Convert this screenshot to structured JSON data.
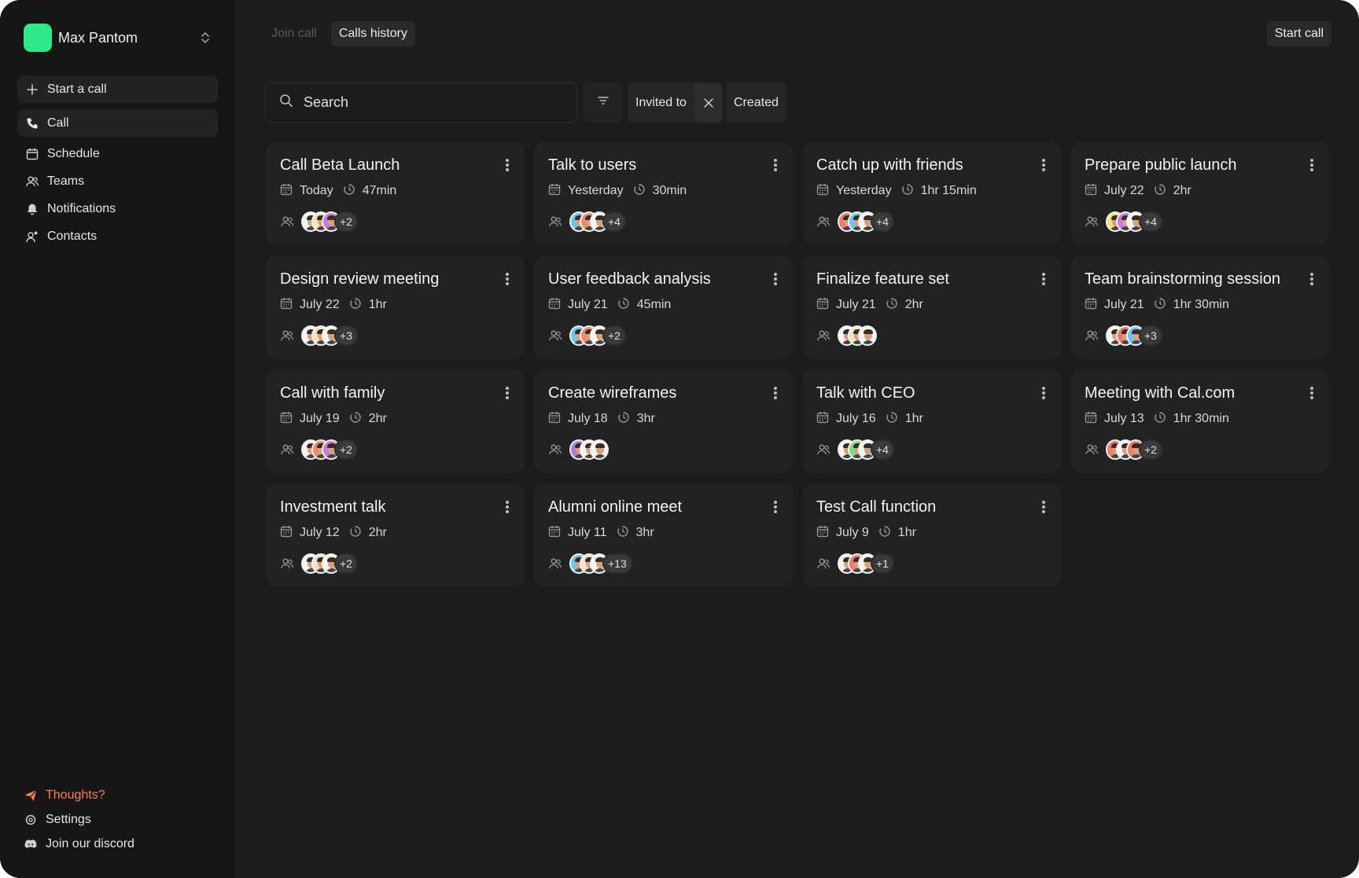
{
  "account": {
    "name": "Max Pantom",
    "color": "#2ee88c"
  },
  "sidebar": {
    "items": [
      {
        "label": "Start a call",
        "icon": "plus-icon"
      },
      {
        "label": "Call",
        "icon": "phone-icon"
      },
      {
        "label": "Schedule",
        "icon": "calendar-icon"
      },
      {
        "label": "Teams",
        "icon": "users-icon"
      },
      {
        "label": "Notifications",
        "icon": "bell-icon"
      },
      {
        "label": "Contacts",
        "icon": "contacts-icon"
      }
    ],
    "bottom": [
      {
        "label": "Thoughts?",
        "icon": "send-icon",
        "color": "#ff7c50"
      },
      {
        "label": "Settings",
        "icon": "gear-icon"
      },
      {
        "label": "Join our discord",
        "icon": "discord-icon"
      }
    ]
  },
  "topbar": {
    "tabs": [
      {
        "label": "Join call",
        "active": false
      },
      {
        "label": "Calls history",
        "active": true
      }
    ],
    "start_call": "Start call"
  },
  "filters": {
    "search_placeholder": "Search",
    "chips": [
      {
        "label": "Invited to",
        "removable": true
      },
      {
        "label": "Created",
        "removable": false
      }
    ]
  },
  "calls": [
    {
      "title": "Call Beta Launch",
      "date": "Today",
      "duration": "47min",
      "avatars": [
        "#f4f4f4",
        "#f1e4c4",
        "#c77be0"
      ],
      "extra": "+2"
    },
    {
      "title": "Talk to users",
      "date": "Yesterday",
      "duration": "30min",
      "avatars": [
        "#6ec6f0",
        "#f08a6e",
        "#f4f4f4"
      ],
      "extra": "+4"
    },
    {
      "title": "Catch up with friends",
      "date": "Yesterday",
      "duration": "1hr 15min",
      "avatars": [
        "#f07a6e",
        "#6ec6f0",
        "#f4f4f4"
      ],
      "extra": "+4"
    },
    {
      "title": "Prepare public launch",
      "date": "July 22",
      "duration": "2hr",
      "avatars": [
        "#f2e66a",
        "#c77be0",
        "#f4f4f4"
      ],
      "extra": "+4"
    },
    {
      "title": "Design review meeting",
      "date": "July 22",
      "duration": "1hr",
      "avatars": [
        "#f4f4f4",
        "#f1e4c4",
        "#f4f4f4"
      ],
      "extra": "+3"
    },
    {
      "title": "User feedback analysis",
      "date": "July 21",
      "duration": "45min",
      "avatars": [
        "#6ec6f0",
        "#f08a6e",
        "#f4f4f4"
      ],
      "extra": "+2"
    },
    {
      "title": "Finalize feature set",
      "date": "July 21",
      "duration": "2hr",
      "avatars": [
        "#f4f4f4",
        "#f1e4c4",
        "#f4f4f4"
      ],
      "extra": ""
    },
    {
      "title": "Team brainstorming session",
      "date": "July 21",
      "duration": "1hr 30min",
      "avatars": [
        "#f4f4f4",
        "#f07a6e",
        "#6ec6f0"
      ],
      "extra": "+3"
    },
    {
      "title": "Call with family",
      "date": "July 19",
      "duration": "2hr",
      "avatars": [
        "#f4f4f4",
        "#f08a6e",
        "#c77be0"
      ],
      "extra": "+2"
    },
    {
      "title": "Create wireframes",
      "date": "July 18",
      "duration": "3hr",
      "avatars": [
        "#b27be0",
        "#f4f4f4",
        "#f4f4f4"
      ],
      "extra": ""
    },
    {
      "title": "Talk with CEO",
      "date": "July 16",
      "duration": "1hr",
      "avatars": [
        "#f4f4f4",
        "#7be07f",
        "#f4f4f4"
      ],
      "extra": "+4"
    },
    {
      "title": "Meeting with Cal.com",
      "date": "July 13",
      "duration": "1hr 30min",
      "avatars": [
        "#f07a6e",
        "#f4f4f4",
        "#f07a6e"
      ],
      "extra": "+2"
    },
    {
      "title": "Investment talk",
      "date": "July 12",
      "duration": "2hr",
      "avatars": [
        "#f4f4f4",
        "#f1e4c4",
        "#f4f4f4"
      ],
      "extra": "+2"
    },
    {
      "title": "Alumni online meet",
      "date": "July 11",
      "duration": "3hr",
      "avatars": [
        "#6ec6f0",
        "#f1e4c4",
        "#f4f4f4"
      ],
      "extra": "+13"
    },
    {
      "title": "Test Call function",
      "date": "July 9",
      "duration": "1hr",
      "avatars": [
        "#f4f4f4",
        "#f07a6e",
        "#f4f4f4"
      ],
      "extra": "+1"
    }
  ]
}
